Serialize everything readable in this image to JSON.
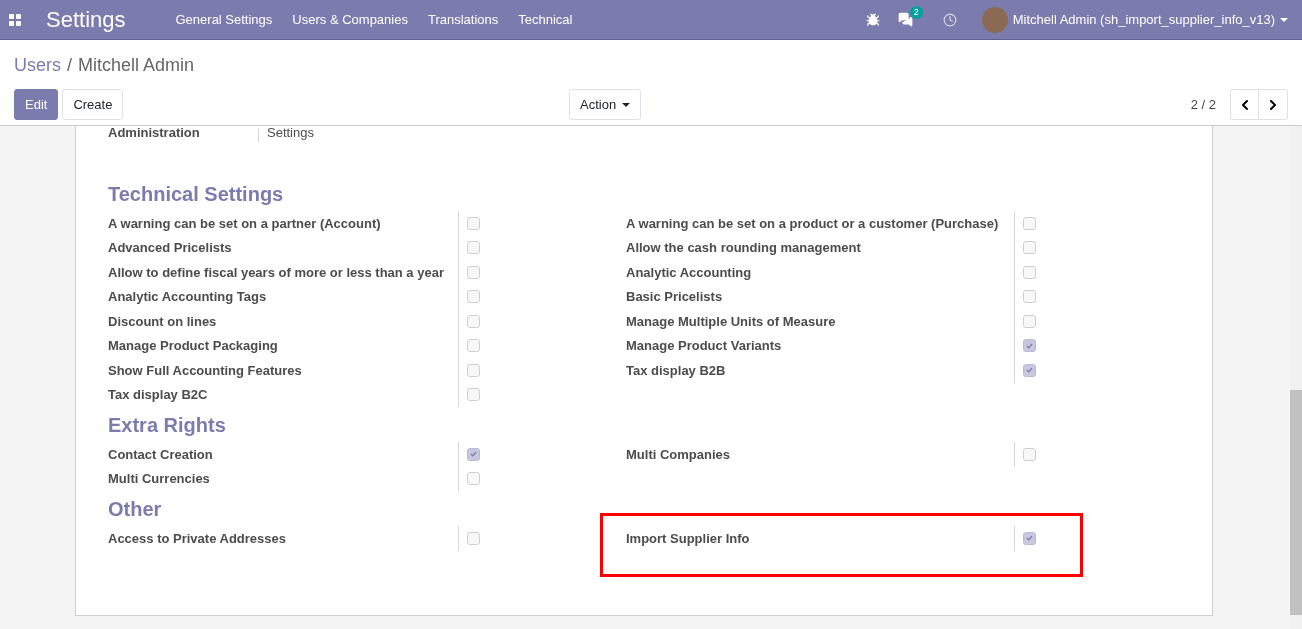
{
  "navbar": {
    "app_title": "Settings",
    "menu": [
      "General Settings",
      "Users & Companies",
      "Translations",
      "Technical"
    ],
    "messages_badge": "2",
    "user": "Mitchell Admin (sh_import_supplier_info_v13)"
  },
  "breadcrumb": {
    "parent": "Users",
    "separator": "/",
    "current": "Mitchell Admin"
  },
  "buttons": [
    "Edit",
    "Create"
  ],
  "action_menu": "Action",
  "pager": "2 / 2",
  "top_field": {
    "label": "Administration",
    "value": "Settings"
  },
  "sections": [
    {
      "title": "Technical Settings",
      "columns": [
        [
          {
            "label": "A warning can be set on a partner (Account)",
            "checked": false,
            "highlighted": false
          },
          {
            "label": "Advanced Pricelists",
            "checked": false,
            "highlighted": false
          },
          {
            "label": "Allow to define fiscal years of more or less than a year",
            "checked": false,
            "highlighted": false
          },
          {
            "label": "Analytic Accounting Tags",
            "checked": false,
            "highlighted": false
          },
          {
            "label": "Discount on lines",
            "checked": false,
            "highlighted": false
          },
          {
            "label": "Manage Product Packaging",
            "checked": false,
            "highlighted": false
          },
          {
            "label": "Show Full Accounting Features",
            "checked": false,
            "highlighted": false
          },
          {
            "label": "Tax display B2C",
            "checked": false,
            "highlighted": false
          }
        ],
        [
          {
            "label": "A warning can be set on a product or a customer (Purchase)",
            "checked": false,
            "highlighted": false
          },
          {
            "label": "Allow the cash rounding management",
            "checked": false,
            "highlighted": false
          },
          {
            "label": "Analytic Accounting",
            "checked": false,
            "highlighted": false
          },
          {
            "label": "Basic Pricelists",
            "checked": false,
            "highlighted": false
          },
          {
            "label": "Manage Multiple Units of Measure",
            "checked": false,
            "highlighted": false
          },
          {
            "label": "Manage Product Variants",
            "checked": true,
            "highlighted": false
          },
          {
            "label": "Tax display B2B",
            "checked": true,
            "highlighted": false
          }
        ]
      ]
    },
    {
      "title": "Extra Rights",
      "columns": [
        [
          {
            "label": "Contact Creation",
            "checked": true,
            "highlighted": false
          },
          {
            "label": "Multi Currencies",
            "checked": false,
            "highlighted": false
          }
        ],
        [
          {
            "label": "Multi Companies",
            "checked": false,
            "highlighted": false
          }
        ]
      ]
    },
    {
      "title": "Other",
      "columns": [
        [
          {
            "label": "Access to Private Addresses",
            "checked": false,
            "highlighted": false
          }
        ],
        [
          {
            "label": "Import Supplier Info",
            "checked": true,
            "highlighted": true
          }
        ]
      ]
    }
  ]
}
